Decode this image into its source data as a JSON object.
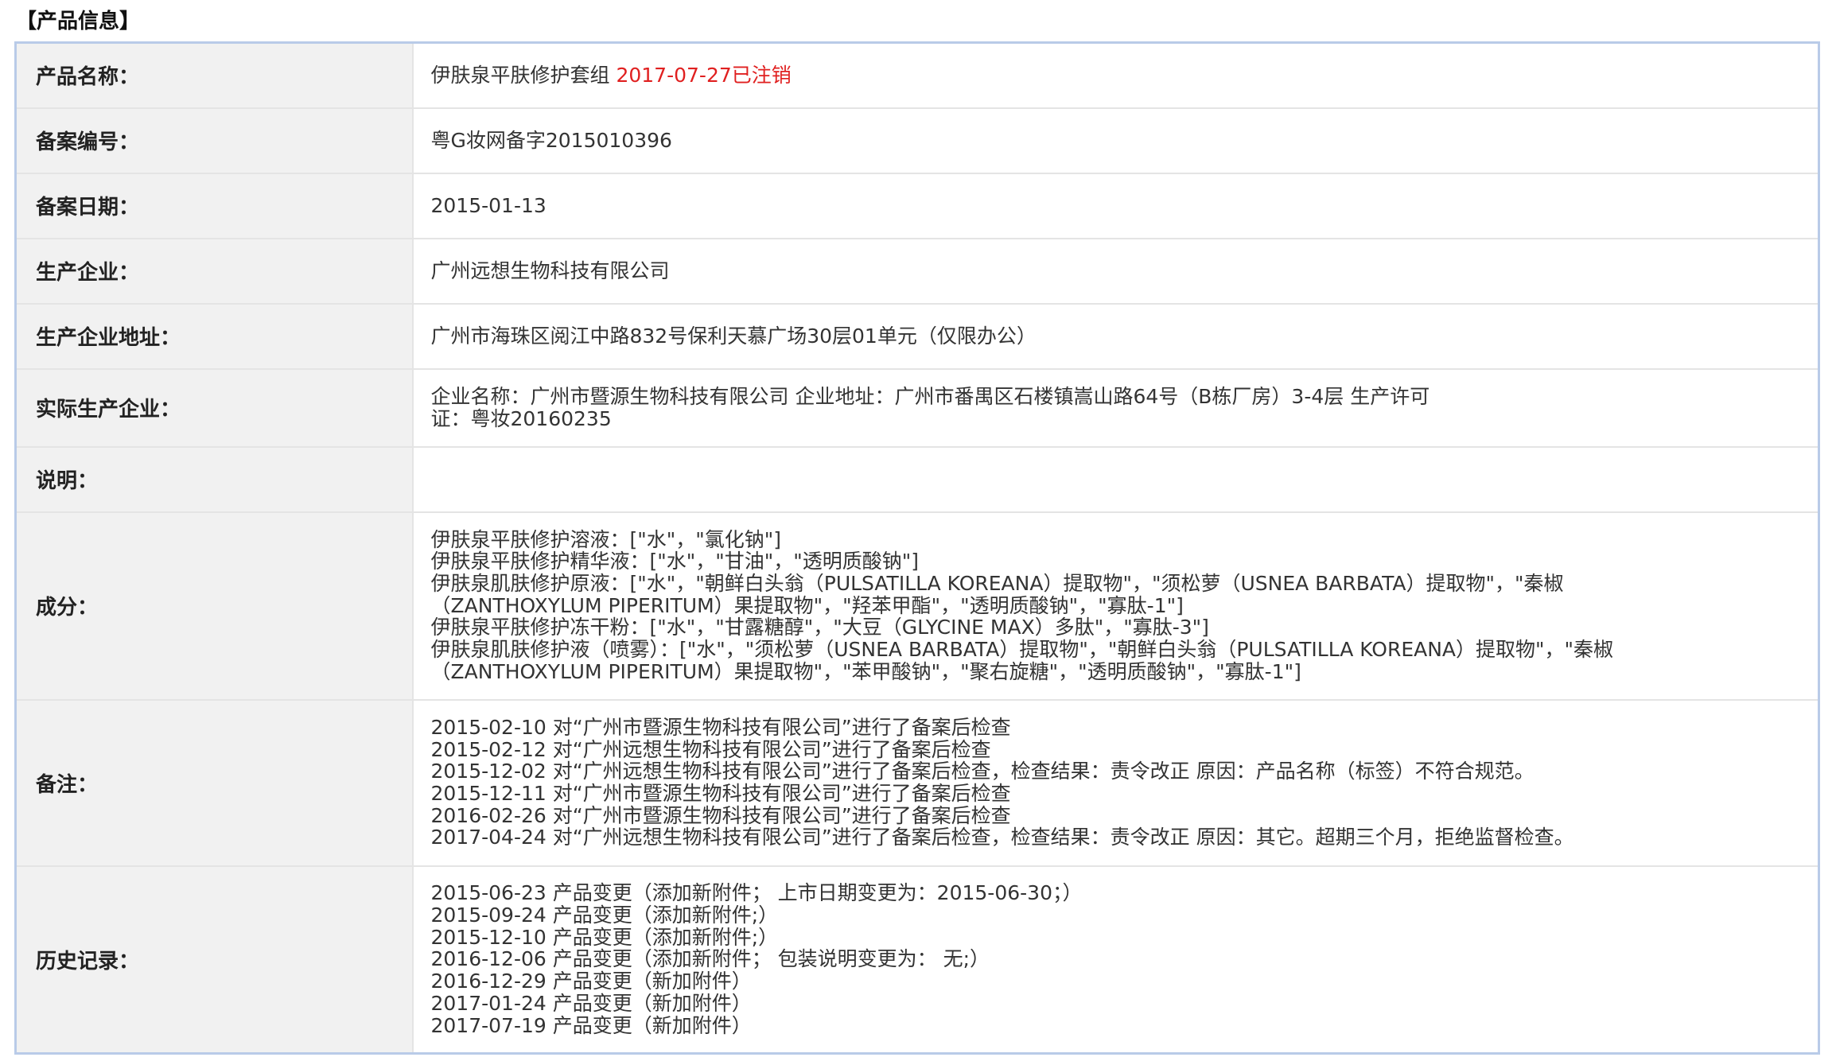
{
  "section": {
    "title": "【产品信息】"
  },
  "rows": {
    "product_name": {
      "label": "产品名称：",
      "value": "伊肤泉平肤修护套组",
      "status": "2017-07-27已注销"
    },
    "record_no": {
      "label": "备案编号：",
      "value": "粤G妆网备字2015010396"
    },
    "record_date": {
      "label": "备案日期：",
      "value": "2015-01-13"
    },
    "manufacturer": {
      "label": "生产企业：",
      "value": "广州远想生物科技有限公司"
    },
    "manufacturer_address": {
      "label": "生产企业地址：",
      "value": "广州市海珠区阅江中路832号保利天慕广场30层01单元（仅限办公）"
    },
    "actual_manufacturer": {
      "label": "实际生产企业：",
      "lines": [
        "企业名称：广州市暨源生物科技有限公司 企业地址：广州市番禺区石楼镇嵩山路64号（B栋厂房）3-4层 生产许可",
        "证：粤妆20160235"
      ]
    },
    "description": {
      "label": "说明：",
      "value": ""
    },
    "ingredients": {
      "label": "成分：",
      "lines": [
        "伊肤泉平肤修护溶液：[\"水\"，\"氯化钠\"]",
        "伊肤泉平肤修护精华液：[\"水\"，\"甘油\"，\"透明质酸钠\"]",
        "伊肤泉肌肤修护原液：[\"水\"，\"朝鲜白头翁（PULSATILLA KOREANA）提取物\"，\"须松萝（USNEA BARBATA）提取物\"，\"秦椒",
        "（ZANTHOXYLUM PIPERITUM）果提取物\"，\"羟苯甲酯\"，\"透明质酸钠\"，\"寡肽-1\"]",
        "伊肤泉平肤修护冻干粉：[\"水\"，\"甘露糖醇\"，\"大豆（GLYCINE MAX）多肽\"，\"寡肽-3\"]",
        "伊肤泉肌肤修护液（喷雾）：[\"水\"，\"须松萝（USNEA BARBATA）提取物\"，\"朝鲜白头翁（PULSATILLA KOREANA）提取物\"，\"秦椒",
        "（ZANTHOXYLUM PIPERITUM）果提取物\"，\"苯甲酸钠\"，\"聚右旋糖\"，\"透明质酸钠\"，\"寡肽-1\"]"
      ]
    },
    "remarks": {
      "label": "备注：",
      "lines": [
        "2015-02-10 对“广州市暨源生物科技有限公司”进行了备案后检查",
        "2015-02-12 对“广州远想生物科技有限公司”进行了备案后检查",
        "2015-12-02 对“广州远想生物科技有限公司”进行了备案后检查，检查结果：责令改正 原因：产品名称（标签）不符合规范。",
        "2015-12-11 对“广州市暨源生物科技有限公司”进行了备案后检查",
        "2016-02-26 对“广州市暨源生物科技有限公司”进行了备案后检查",
        "2017-04-24 对“广州远想生物科技有限公司”进行了备案后检查，检查结果：责令改正 原因：其它。超期三个月，拒绝监督检查。"
      ]
    },
    "history": {
      "label": "历史记录：",
      "lines": [
        "2015-06-23 产品变更（添加新附件； 上市日期变更为：2015-06-30；）",
        "2015-09-24 产品变更（添加新附件;）",
        "2015-12-10 产品变更（添加新附件;）",
        "2016-12-06 产品变更（添加新附件； 包装说明变更为： 无;）",
        "2016-12-29 产品变更（新加附件）",
        "2017-01-24 产品变更（新加附件）",
        "2017-07-19 产品变更（新加附件）"
      ]
    }
  },
  "colors": {
    "status_red": "#e02020",
    "label_bg": "#f1f1f1",
    "table_border": "#b9cbe8"
  }
}
